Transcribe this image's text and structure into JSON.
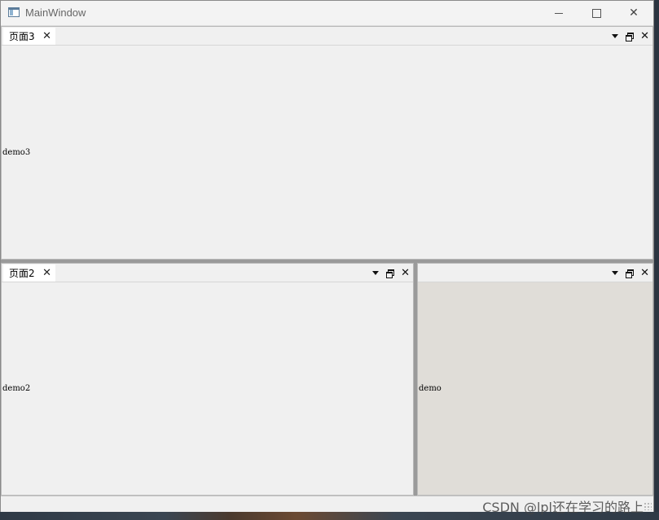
{
  "window": {
    "title": "MainWindow",
    "icon": "app-window-icon",
    "controls": [
      "minimize-icon",
      "maximize-icon",
      "close-icon"
    ]
  },
  "docks": {
    "top": {
      "tab_label": "页面3",
      "tab_close": "✕",
      "content_text": "demo3",
      "buttons": [
        "dropdown-icon",
        "float-icon",
        "close-icon"
      ]
    },
    "left": {
      "tab_label": "页面2",
      "tab_close": "✕",
      "content_text": "demo2",
      "buttons": [
        "dropdown-icon",
        "float-icon",
        "close-icon"
      ]
    },
    "right": {
      "tab_label": "",
      "content_text": "demo",
      "buttons": [
        "dropdown-icon",
        "float-icon",
        "close-icon"
      ]
    }
  },
  "statusbar": {
    "watermark": "CSDN @lpl还在学习的路上"
  },
  "colors": {
    "panel_bg": "#f0f0f0",
    "right_panel_bg": "#e0ddd8",
    "splitter": "#9a9a9a",
    "tab_bg": "#ffffff"
  }
}
